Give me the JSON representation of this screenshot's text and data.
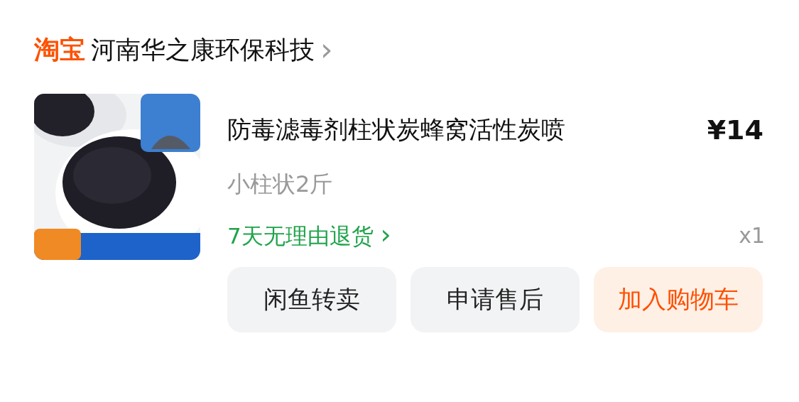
{
  "shop": {
    "platform": "淘宝",
    "name": "河南华之康环保科技",
    "chevron": "›"
  },
  "item": {
    "title": "防毒滤毒剂柱状炭蜂窝活性炭喷",
    "price": "¥14",
    "spec": "小柱状2斤",
    "return_policy": "7天无理由退货",
    "return_chevron": "›",
    "quantity": "x1"
  },
  "actions": [
    {
      "label": "闲鱼转卖",
      "kind": "plain"
    },
    {
      "label": "申请售后",
      "kind": "plain"
    },
    {
      "label": "加入购物车",
      "kind": "primary"
    }
  ]
}
